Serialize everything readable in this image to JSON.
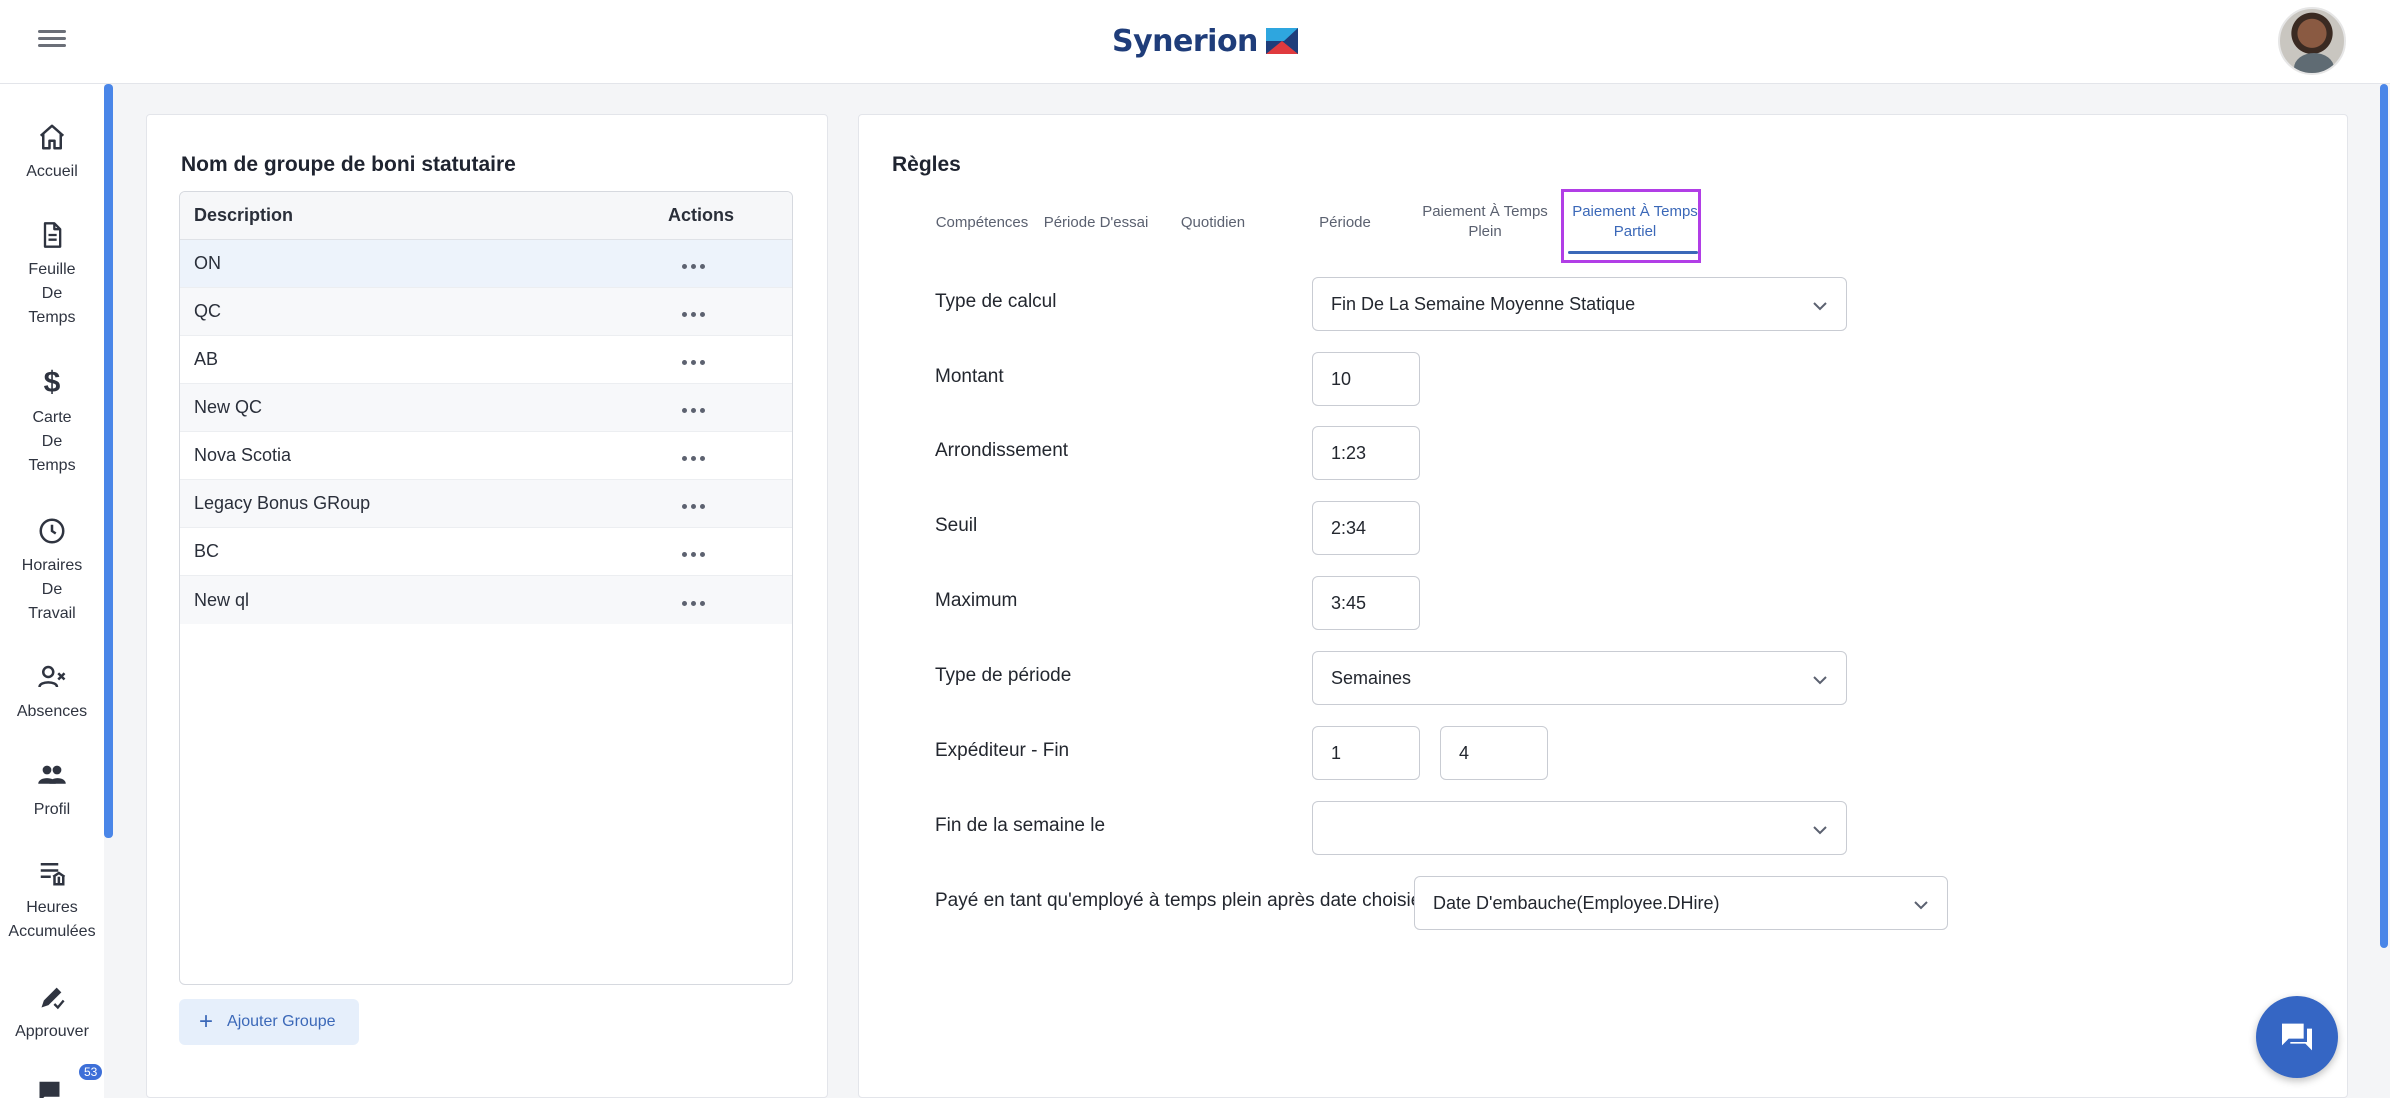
{
  "app": {
    "brand": "Synerion"
  },
  "nav": {
    "items": [
      {
        "label": "Accueil",
        "icon": "home-icon"
      },
      {
        "label": "Feuille\nDe\nTemps",
        "icon": "document-icon"
      },
      {
        "label": "Carte\nDe\nTemps",
        "icon": "dollar-icon"
      },
      {
        "label": "Horaires\nDe\nTravail",
        "icon": "clock-icon"
      },
      {
        "label": "Absences",
        "icon": "person-x-icon"
      },
      {
        "label": "Profil",
        "icon": "people-icon"
      },
      {
        "label": "Heures\nAccumulées",
        "icon": "accrual-icon"
      },
      {
        "label": "Approuver",
        "icon": "approve-icon"
      }
    ],
    "badge": "53"
  },
  "groups": {
    "title": "Nom de groupe de boni statutaire",
    "columns": {
      "description": "Description",
      "actions": "Actions"
    },
    "rows": [
      "ON",
      "QC",
      "AB",
      "New QC",
      "Nova Scotia",
      "Legacy Bonus GRoup",
      "BC",
      "New ql"
    ],
    "selected_index": 0,
    "add_label": "Ajouter Groupe"
  },
  "rules": {
    "title": "Règles",
    "tabs": [
      {
        "label": "Compétences"
      },
      {
        "label": "Période D'essai"
      },
      {
        "label": "Quotidien"
      },
      {
        "label": "Période"
      },
      {
        "label": "Paiement À Temps\nPlein"
      },
      {
        "label": "Paiement À Temps\nPartiel"
      }
    ],
    "active_tab": 5,
    "form": {
      "calc_type_label": "Type de calcul",
      "calc_type_value": "Fin De La Semaine Moyenne Statique",
      "amount_label": "Montant",
      "amount_value": "10",
      "rounding_label": "Arrondissement",
      "rounding_value": "1:23",
      "threshold_label": "Seuil",
      "threshold_value": "2:34",
      "maximum_label": "Maximum",
      "maximum_value": "3:45",
      "period_type_label": "Type de période",
      "period_type_value": "Semaines",
      "sender_end_label": "Expéditeur - Fin",
      "sender_value": "1",
      "end_value": "4",
      "week_end_label": "Fin de la semaine le",
      "week_end_value": "",
      "paid_after_label": "Payé en tant qu'employé à temps plein après date choisie.",
      "paid_after_value": "Date D'embauche(Employee.DHire)"
    }
  },
  "colors": {
    "accent": "#3b68b8",
    "highlight": "#b13ee6",
    "scroll": "#4a86e8",
    "fab": "#3566c4"
  }
}
